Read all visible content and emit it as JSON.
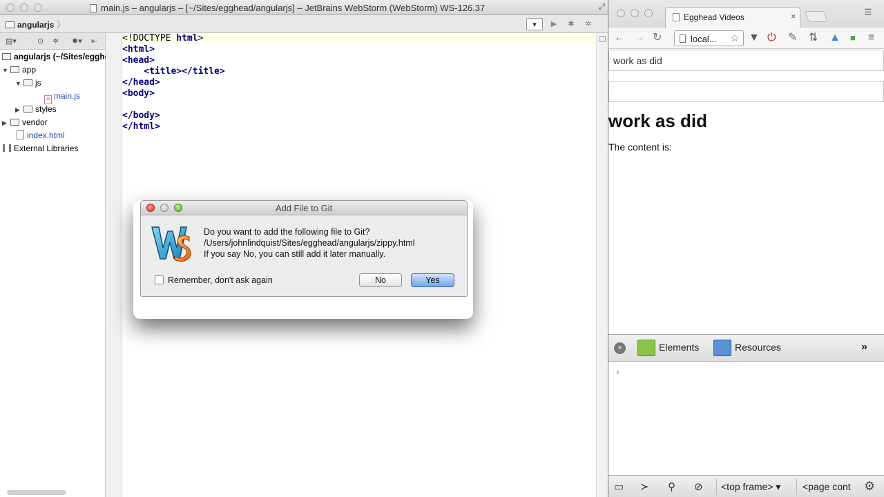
{
  "ide": {
    "window_title": "main.js – angularjs – [~/Sites/egghead/angularjs] – JetBrains WebStorm (WebStorm) WS-126.37",
    "breadcrumb": "angularjs",
    "project_root": "angularjs (~/Sites/egghead/angularjs)",
    "tree": [
      {
        "label": "app",
        "type": "folder",
        "expanded": true
      },
      {
        "label": "js",
        "type": "folder",
        "expanded": true
      },
      {
        "label": "main.js",
        "type": "js-file"
      },
      {
        "label": "styles",
        "type": "folder",
        "expanded": false
      },
      {
        "label": "vendor",
        "type": "folder",
        "expanded": false
      },
      {
        "label": "index.html",
        "type": "html-file"
      },
      {
        "label": "External Libraries",
        "type": "library"
      }
    ],
    "code_lines": [
      "<!DOCTYPE html>",
      "<html>",
      "<head>",
      "    <title></title>",
      "</head>",
      "<body>",
      "",
      "</body>",
      "</html>"
    ]
  },
  "dialog": {
    "title": "Add File to Git",
    "message_lines": [
      "Do you want to add the following file to Git?",
      "/Users/johnlindquist/Sites/egghead/angularjs/zippy.html",
      "If you say No, you can still add it later manually."
    ],
    "remember_label": "Remember, don't ask again",
    "remember_checked": false,
    "no_label": "No",
    "yes_label": "Yes",
    "default_button": "Yes"
  },
  "browser": {
    "tab_title": "Egghead Videos",
    "url": "local...",
    "page": {
      "input_value": "work as did",
      "input2_value": "",
      "heading": "work as did",
      "paragraph": "The content is:"
    },
    "devtools": {
      "tabs": [
        "Elements",
        "Resources"
      ],
      "prompt": "›",
      "frame_select": "<top frame>",
      "context_select": "<page cont",
      "more": "»"
    }
  },
  "colors": {
    "keyword_navy": "#000080",
    "link_blue": "#1e4aa8",
    "yes_button": "#6ea6ea",
    "current_line": "#fffde6"
  },
  "icons": {
    "dialog_logo": "webstorm-logo",
    "close": "close-icon",
    "search": "search-icon",
    "gear": "gear-icon"
  }
}
